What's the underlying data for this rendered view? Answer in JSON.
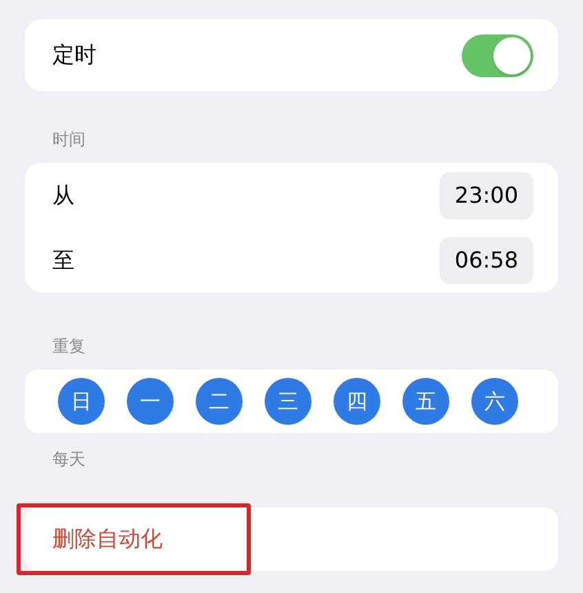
{
  "schedule": {
    "label": "定时",
    "on": true
  },
  "time": {
    "header": "时间",
    "rows": [
      {
        "label": "从",
        "value": "23:00"
      },
      {
        "label": "至",
        "value": "06:58"
      }
    ]
  },
  "repeat": {
    "header": "重复",
    "days": [
      {
        "label": "日",
        "selected": true
      },
      {
        "label": "一",
        "selected": true
      },
      {
        "label": "二",
        "selected": true
      },
      {
        "label": "三",
        "selected": true
      },
      {
        "label": "四",
        "selected": true
      },
      {
        "label": "五",
        "selected": true
      },
      {
        "label": "六",
        "selected": true
      }
    ],
    "summary": "每天"
  },
  "delete": {
    "label": "删除自动化",
    "highlighted": true
  }
}
